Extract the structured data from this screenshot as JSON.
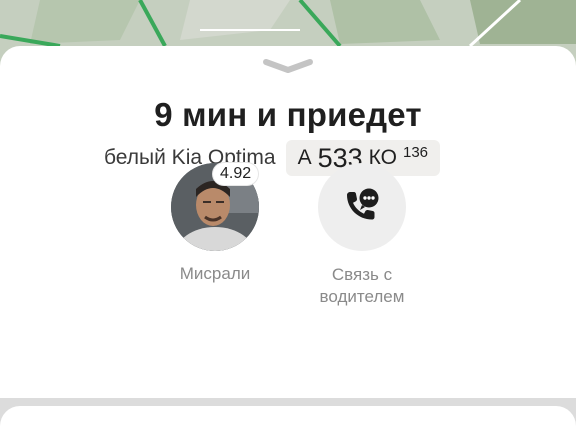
{
  "header": {
    "eta_text": "9 мин и приедет",
    "car_description": "белый Kia Optima"
  },
  "plate": {
    "letter_1": "А",
    "number": "533",
    "letters_2": "КО",
    "region": "136"
  },
  "driver": {
    "rating": "4.92",
    "name": "Мисрали"
  },
  "call": {
    "line_1": "Связь с",
    "line_2": "водителем"
  },
  "colors": {
    "sheet": "#ffffff",
    "map": "#c9d3c4",
    "button_bg": "#eeeeee",
    "plate_bg": "#f0efed"
  }
}
